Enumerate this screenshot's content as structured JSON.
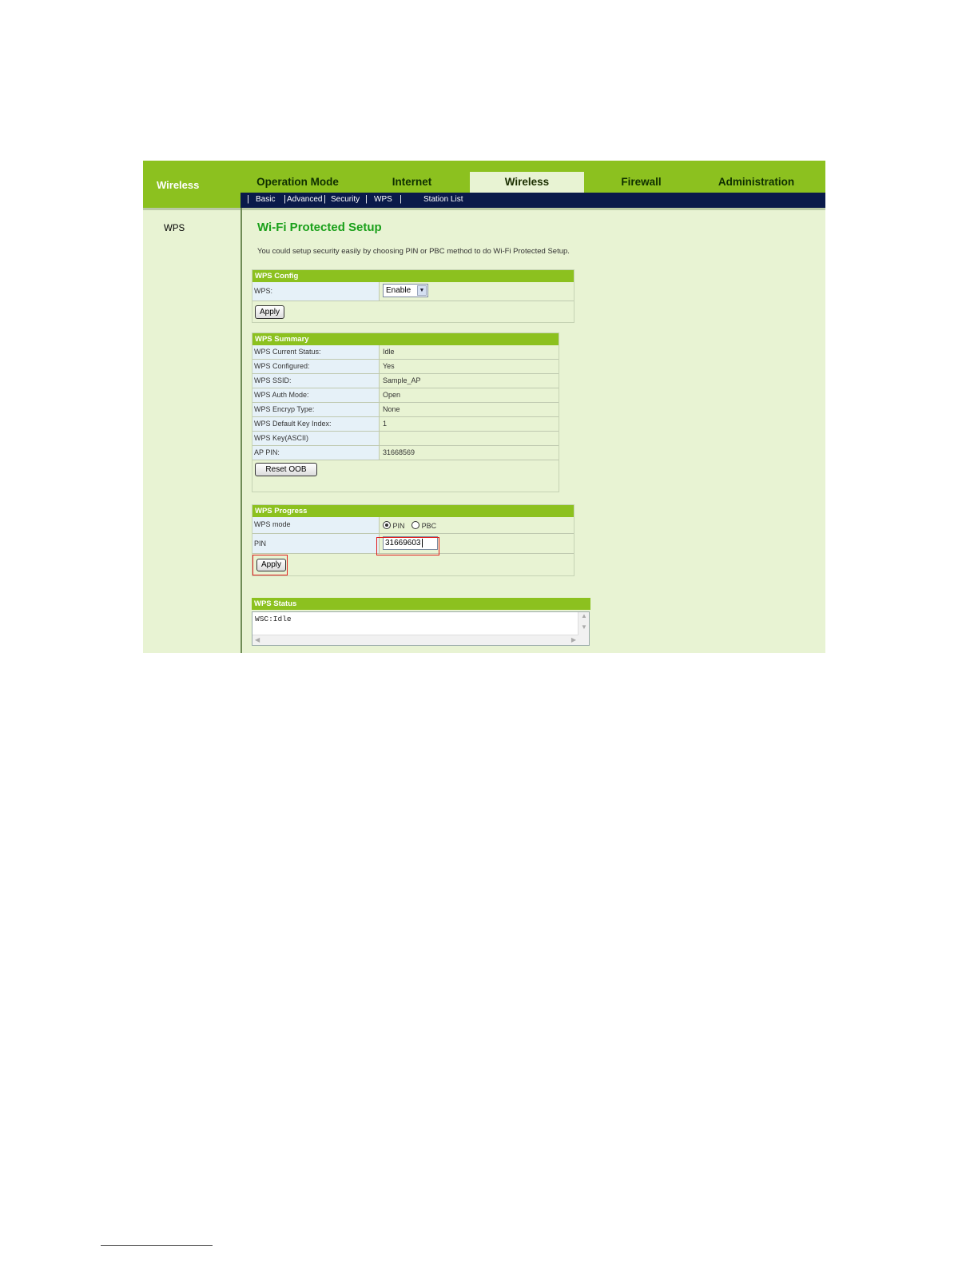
{
  "sidebar": {
    "brand": "Wireless",
    "items": [
      {
        "label": "WPS"
      }
    ]
  },
  "nav": {
    "tabs": [
      {
        "label": "Operation Mode",
        "active": false
      },
      {
        "label": "Internet",
        "active": false
      },
      {
        "label": "Wireless",
        "active": true
      },
      {
        "label": "Firewall",
        "active": false
      },
      {
        "label": "Administration",
        "active": false
      }
    ],
    "subtabs": [
      "Basic",
      "Advanced",
      "Security",
      "WPS",
      "Station List"
    ]
  },
  "page": {
    "title": "Wi-Fi Protected Setup",
    "description": "You could setup security easily by choosing PIN or PBC method to do Wi-Fi Protected Setup."
  },
  "wps_config": {
    "header": "WPS Config",
    "wps_label": "WPS:",
    "wps_value": "Enable",
    "apply_label": "Apply"
  },
  "wps_summary": {
    "header": "WPS Summary",
    "rows": [
      {
        "label": "WPS Current Status:",
        "value": "Idle"
      },
      {
        "label": "WPS Configured:",
        "value": "Yes"
      },
      {
        "label": "WPS SSID:",
        "value": "Sample_AP"
      },
      {
        "label": "WPS Auth Mode:",
        "value": "Open"
      },
      {
        "label": "WPS Encryp Type:",
        "value": "None"
      },
      {
        "label": "WPS Default Key Index:",
        "value": "1"
      },
      {
        "label": "WPS Key(ASCII)",
        "value": ""
      },
      {
        "label": "AP PIN:",
        "value": "31668569"
      }
    ],
    "reset_label": "Reset OOB"
  },
  "wps_progress": {
    "header": "WPS Progress",
    "mode_label": "WPS mode",
    "mode_options": [
      "PIN",
      "PBC"
    ],
    "mode_selected": "PIN",
    "pin_label": "PIN",
    "pin_value": "31669603",
    "apply_label": "Apply"
  },
  "wps_status": {
    "header": "WPS Status",
    "text": "WSC:Idle"
  },
  "colors": {
    "header_green": "#8cc11f",
    "panel_bg": "#e8f3d3",
    "subnav_navy": "#0a1a4a",
    "title_green": "#1aa01a",
    "highlight_red": "#e02020"
  }
}
